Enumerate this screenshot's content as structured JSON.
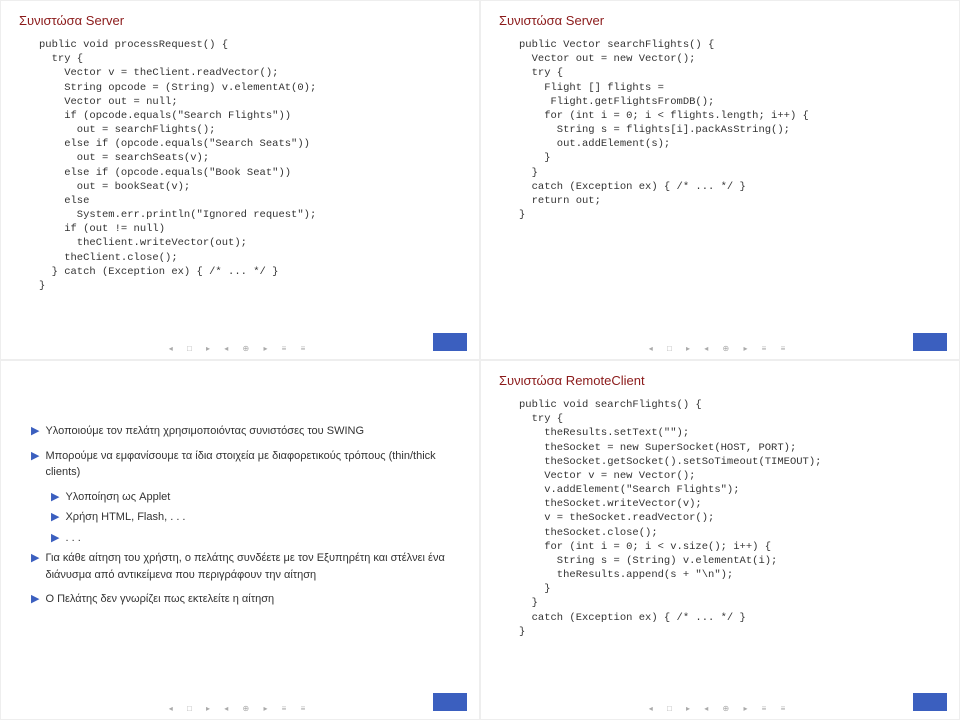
{
  "slides": {
    "tl": {
      "title": "Συνιστώσα Server",
      "code": "public void processRequest() {\n  try {\n    Vector v = theClient.readVector();\n    String opcode = (String) v.elementAt(0);\n    Vector out = null;\n    if (opcode.equals(\"Search Flights\"))\n      out = searchFlights();\n    else if (opcode.equals(\"Search Seats\"))\n      out = searchSeats(v);\n    else if (opcode.equals(\"Book Seat\"))\n      out = bookSeat(v);\n    else\n      System.err.println(\"Ignored request\");\n    if (out != null)\n      theClient.writeVector(out);\n    theClient.close();\n  } catch (Exception ex) { /* ... */ }\n}"
    },
    "tr": {
      "title": "Συνιστώσα Server",
      "code": "public Vector searchFlights() {\n  Vector out = new Vector();\n  try {\n    Flight [] flights =\n     Flight.getFlightsFromDB();\n    for (int i = 0; i < flights.length; i++) {\n      String s = flights[i].packAsString();\n      out.addElement(s);\n    }\n  }\n  catch (Exception ex) { /* ... */ }\n  return out;\n}"
    },
    "bl": {
      "b1": "Υλοποιούμε τον πελάτη χρησιμοποιόντας συνιστόσες του SWING",
      "b2": "Μπορούμε να εμφανίσουμε τα ίδια στοιχεία με διαφορετικούς τρόπους (thin/thick clients)",
      "b2a": "Υλοποίηση ως Applet",
      "b2b": "Χρήση HTML, Flash, . . .",
      "b2c": ". . .",
      "b3": "Για κάθε αίτηση του χρήστη, ο πελάτης συνδέετε με τον Εξυπηρέτη και στέλνει ένα διάνυσμα από αντικείμενα που περιγράφουν την αίτηση",
      "b4": "Ο Πελάτης δεν γνωρίζει πως εκτελείτε η αίτηση"
    },
    "br": {
      "title": "Συνιστώσα RemoteClient",
      "code": "public void searchFlights() {\n  try {\n    theResults.setText(\"\");\n    theSocket = new SuperSocket(HOST, PORT);\n    theSocket.getSocket().setSoTimeout(TIMEOUT);\n    Vector v = new Vector();\n    v.addElement(\"Search Flights\");\n    theSocket.writeVector(v);\n    v = theSocket.readVector();\n    theSocket.close();\n    for (int i = 0; i < v.size(); i++) {\n      String s = (String) v.elementAt(i);\n      theResults.append(s + \"\\n\");\n    }\n  }\n  catch (Exception ex) { /* ... */ }\n}"
    }
  },
  "nav": "◂ □ ▸ ◂ ⊕ ▸      ≡      ≡"
}
